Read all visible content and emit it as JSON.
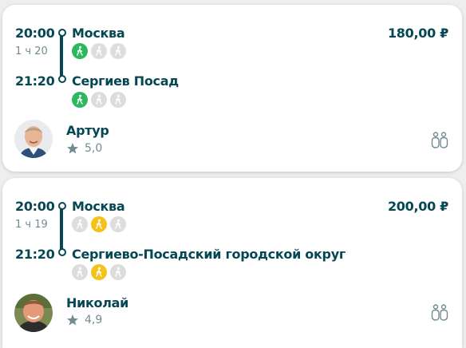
{
  "rides": [
    {
      "depart_time": "20:00",
      "duration": "1 ч 20",
      "arrive_time": "21:20",
      "from_city": "Москва",
      "to_city": "Сергиев Посад",
      "price": "180,00 ₽",
      "driver": {
        "name": "Артур",
        "rating": "5,0"
      },
      "from_indicators": [
        "green",
        "grey",
        "grey"
      ],
      "to_indicators": [
        "green",
        "grey",
        "grey"
      ],
      "icons": [
        "walking-person-icon",
        "star-icon",
        "two-passengers-icon"
      ]
    },
    {
      "depart_time": "20:00",
      "duration": "1 ч 19",
      "arrive_time": "21:20",
      "from_city": "Москва",
      "to_city": "Сергиево-Посадский городской округ",
      "price": "200,00 ₽",
      "driver": {
        "name": "Николай",
        "rating": "4,9"
      },
      "from_indicators": [
        "grey",
        "yellow",
        "grey"
      ],
      "to_indicators": [
        "grey",
        "yellow",
        "grey"
      ],
      "icons": [
        "walking-person-icon",
        "star-icon",
        "two-passengers-icon"
      ]
    }
  ],
  "colors": {
    "text": "#054752",
    "muted": "#708c91",
    "green": "#2db75e",
    "yellow": "#f5c11b",
    "grey": "#dddddd"
  }
}
